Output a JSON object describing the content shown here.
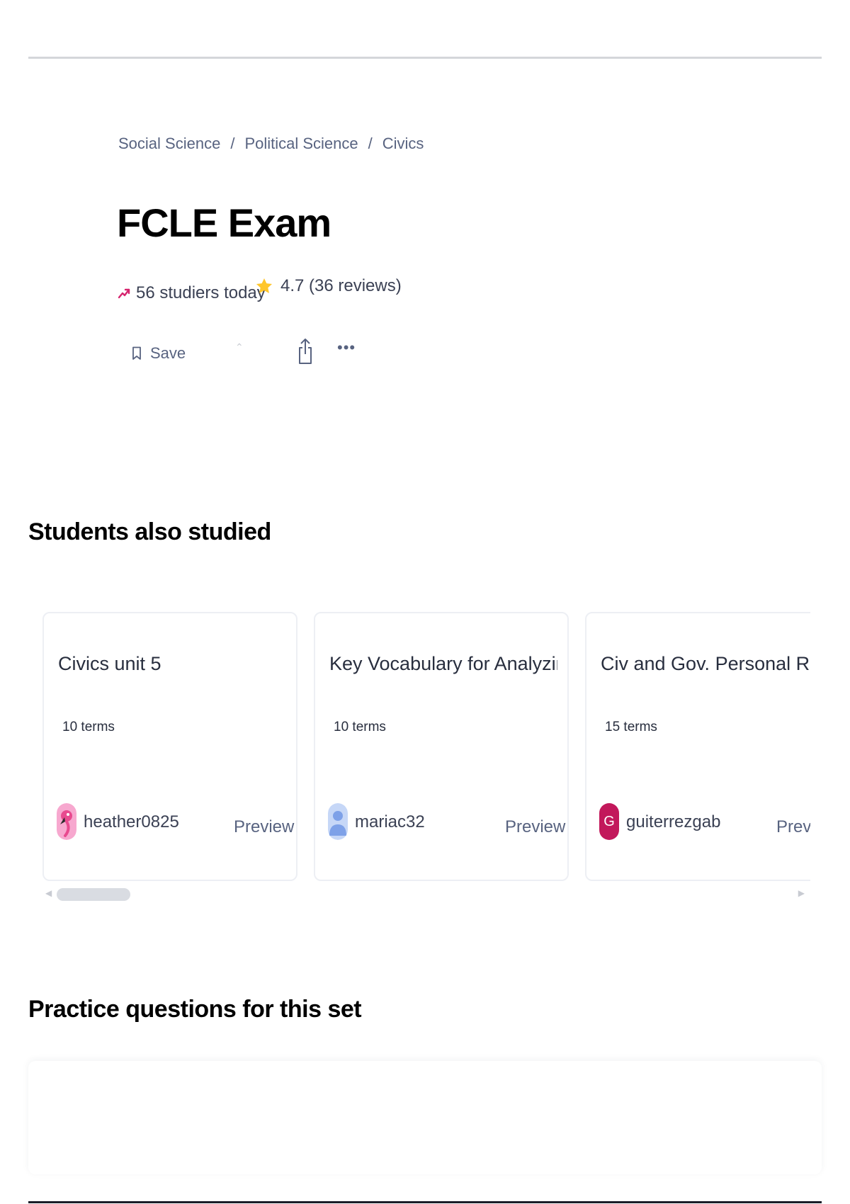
{
  "breadcrumb": {
    "items": [
      "Social Science",
      "Political Science",
      "Civics"
    ],
    "separator": "/"
  },
  "set": {
    "title": "FCLE Exam",
    "studiers": "56 studiers today",
    "rating": "4.7 (36 reviews)"
  },
  "actions": {
    "save_label": "Save",
    "more_label": "•••"
  },
  "students_also_studied": {
    "title": "Students also studied",
    "cards": [
      {
        "title": "Civics unit 5",
        "terms": "10 terms",
        "user": "heather0825",
        "preview": "Preview",
        "avatar": "flamingo-avatar-icon"
      },
      {
        "title": "Key Vocabulary for Analyzing Autho...",
        "terms": "10 terms",
        "user": "mariac32",
        "preview": "Preview",
        "avatar": "default-person-avatar-icon"
      },
      {
        "title": "Civ and Gov. Personal Rights.Study",
        "terms": "15 terms",
        "user": "guiterrezgab",
        "preview": "Preview",
        "avatar_letter": "G"
      }
    ],
    "scroll_left_icon": "chevron-left-icon",
    "scroll_right_icon": "chevron-right-icon"
  },
  "practice_questions": {
    "title": "Practice questions for this set"
  },
  "colors": {
    "accent_trend": "#d6246e",
    "star": "#ffc62b",
    "avatar_g": "#c2185b",
    "avatar_person": "#7ea1e8"
  }
}
